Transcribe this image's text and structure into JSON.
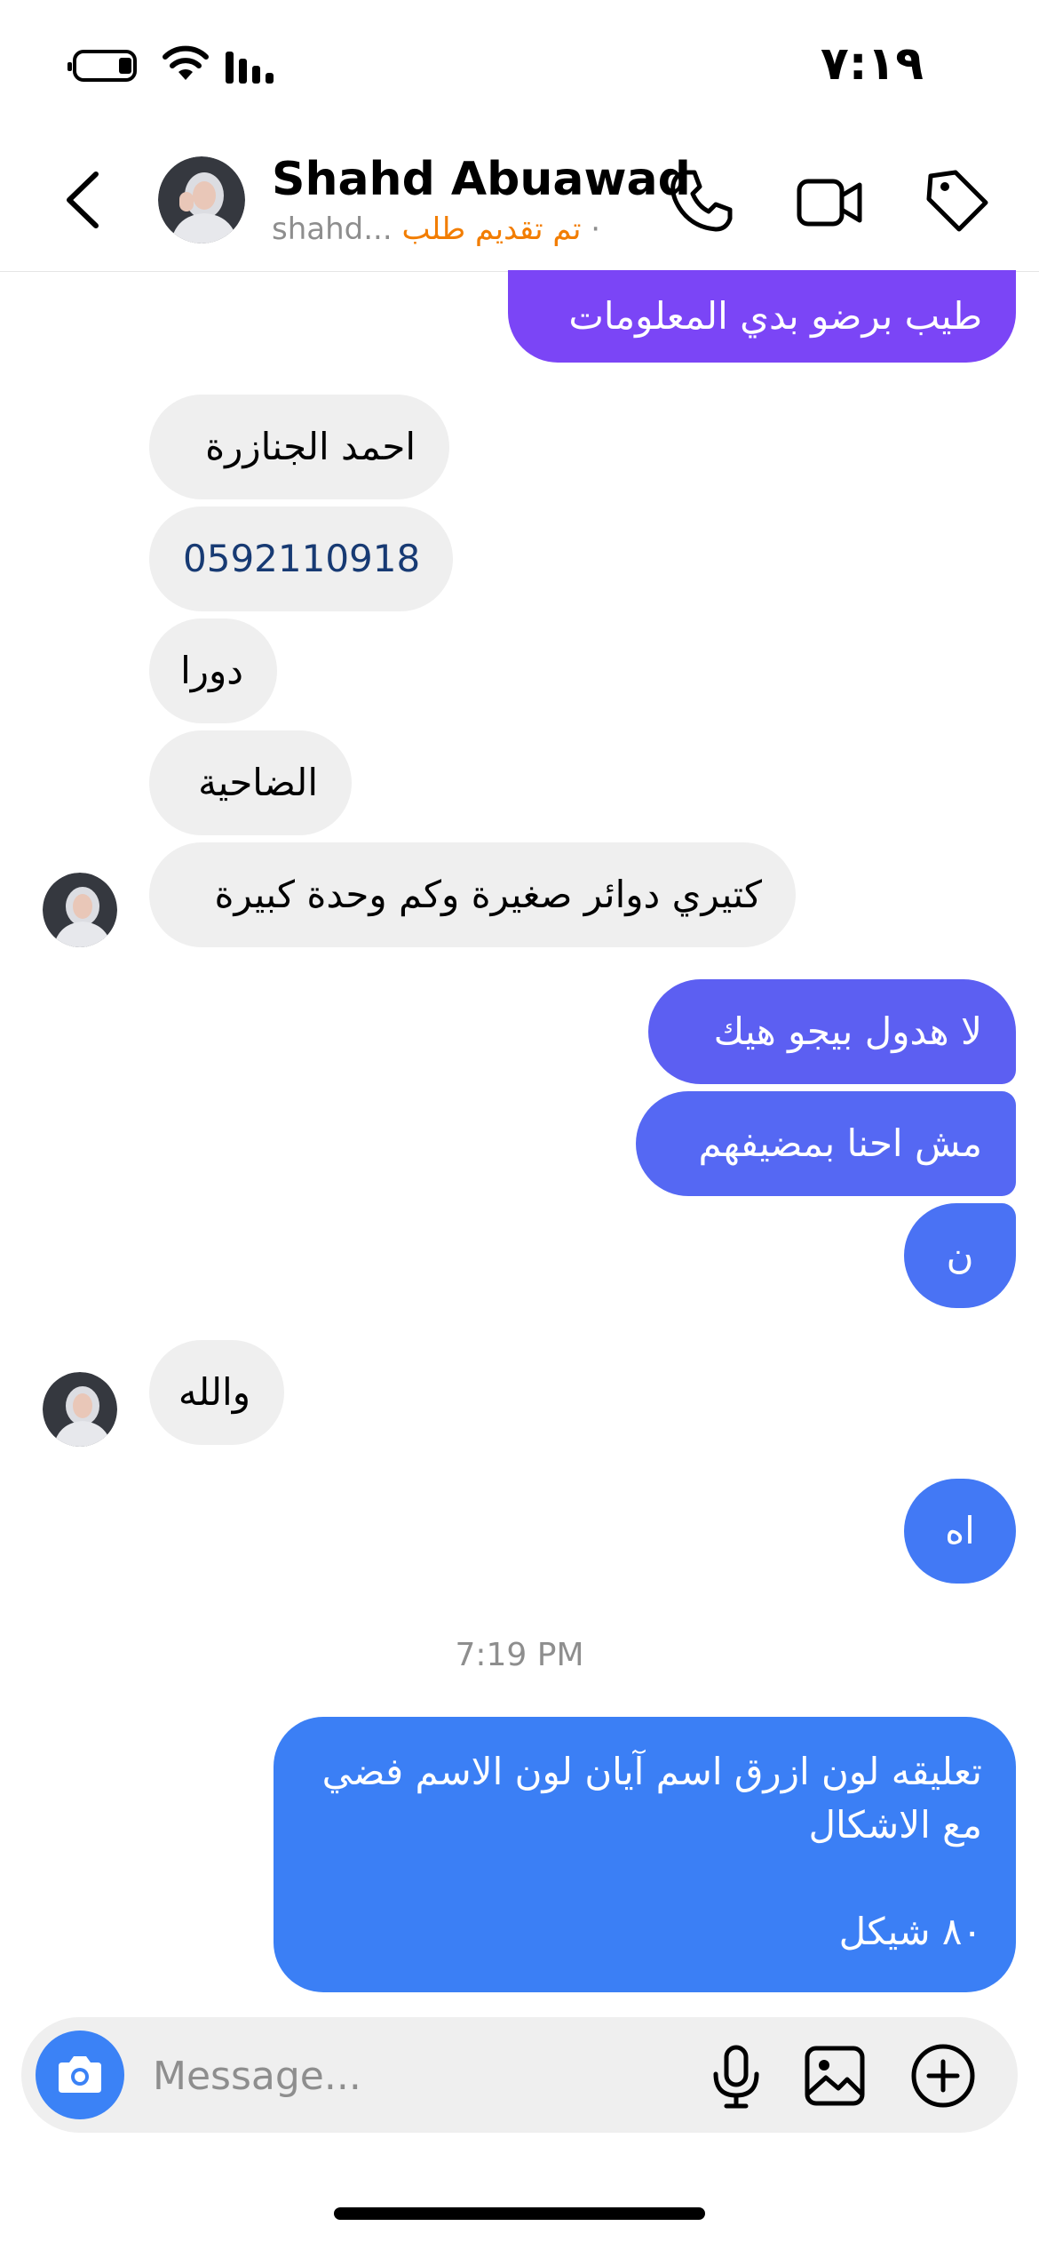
{
  "status_bar": {
    "time": "٧:١٩"
  },
  "header": {
    "contact_name": "Shahd Abuawad",
    "username": "shahd...",
    "separator": "·",
    "request_status": "تم تقديم طلب"
  },
  "messages": [
    {
      "dir": "out",
      "text": "طيب برضو بدي المعلومات"
    },
    {
      "dir": "in",
      "text": "احمد  الجنازرة"
    },
    {
      "dir": "in",
      "text": "0592110918"
    },
    {
      "dir": "in",
      "text": "دورا"
    },
    {
      "dir": "in",
      "text": "الضاحية"
    },
    {
      "dir": "in",
      "text": "كتيري دوائر صغيرة وكم وحدة كبيرة"
    },
    {
      "dir": "out",
      "text": "لا هدول بيجو هيك"
    },
    {
      "dir": "out",
      "text": "مش احنا بمضيفهم"
    },
    {
      "dir": "out",
      "text": "ن"
    },
    {
      "dir": "in",
      "text": "والله"
    },
    {
      "dir": "out",
      "text": "اه"
    },
    {
      "dir": "out",
      "lines": [
        "تعليقه لون ازرق اسم آيان لون الاسم فضي",
        "مع الاشكال",
        "",
        "٨٠ شيكل"
      ]
    }
  ],
  "timestamp": "7:19 PM",
  "composer": {
    "placeholder": "Message..."
  },
  "colors": {
    "outgoing_top": "#7b45f6",
    "outgoing_mid": "#5c5ff2",
    "outgoing_bottom": "#3b7ff5",
    "incoming": "#efefef",
    "request_orange": "#f27d00",
    "camera_button": "#3b82f6"
  },
  "icons": [
    "back-chevron-icon",
    "phone-icon",
    "video-icon",
    "tag-icon",
    "camera-icon",
    "microphone-icon",
    "image-icon",
    "plus-icon"
  ]
}
